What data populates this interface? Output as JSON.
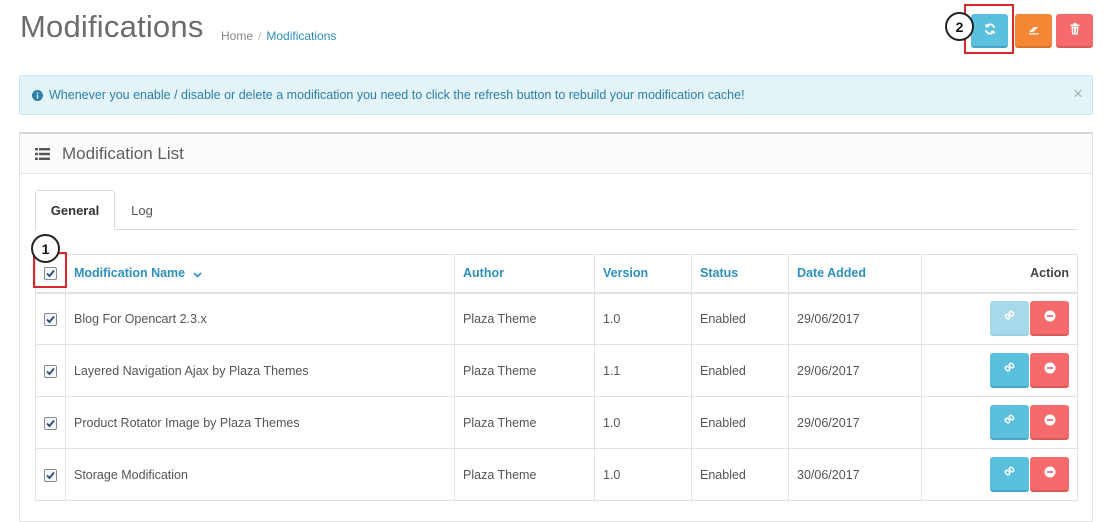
{
  "header": {
    "title": "Modifications",
    "breadcrumb": [
      {
        "label": "Home"
      },
      {
        "label": "Modifications"
      }
    ]
  },
  "toolbar": {
    "refresh_icon": "refresh-icon",
    "clear_icon": "eraser-icon",
    "delete_icon": "trash-icon"
  },
  "annotations": {
    "marker_1": "1",
    "marker_2": "2"
  },
  "alert": {
    "text": "Whenever you enable / disable or delete a modification you need to click the refresh button to rebuild your modification cache!",
    "close": "×"
  },
  "panel": {
    "title": "Modification List"
  },
  "tabs": [
    {
      "label": "General",
      "active": true
    },
    {
      "label": "Log",
      "active": false
    }
  ],
  "table": {
    "columns": {
      "name": "Modification Name",
      "author": "Author",
      "version": "Version",
      "status": "Status",
      "date_added": "Date Added",
      "action": "Action"
    },
    "select_all_checked": true,
    "rows": [
      {
        "checked": true,
        "name": "Blog For Opencart 2.3.x",
        "author": "Plaza Theme",
        "version": "1.0",
        "status": "Enabled",
        "date_added": "29/06/2017",
        "link_disabled": true
      },
      {
        "checked": true,
        "name": "Layered Navigation Ajax by Plaza Themes",
        "author": "Plaza Theme",
        "version": "1.1",
        "status": "Enabled",
        "date_added": "29/06/2017",
        "link_disabled": false
      },
      {
        "checked": true,
        "name": "Product Rotator Image by Plaza Themes",
        "author": "Plaza Theme",
        "version": "1.0",
        "status": "Enabled",
        "date_added": "29/06/2017",
        "link_disabled": false
      },
      {
        "checked": true,
        "name": "Storage Modification",
        "author": "Plaza Theme",
        "version": "1.0",
        "status": "Enabled",
        "date_added": "30/06/2017",
        "link_disabled": false
      }
    ]
  },
  "colors": {
    "info": "#5bc0de",
    "warning": "#f38733",
    "danger": "#f56b6b",
    "link": "#2c8fbf"
  }
}
